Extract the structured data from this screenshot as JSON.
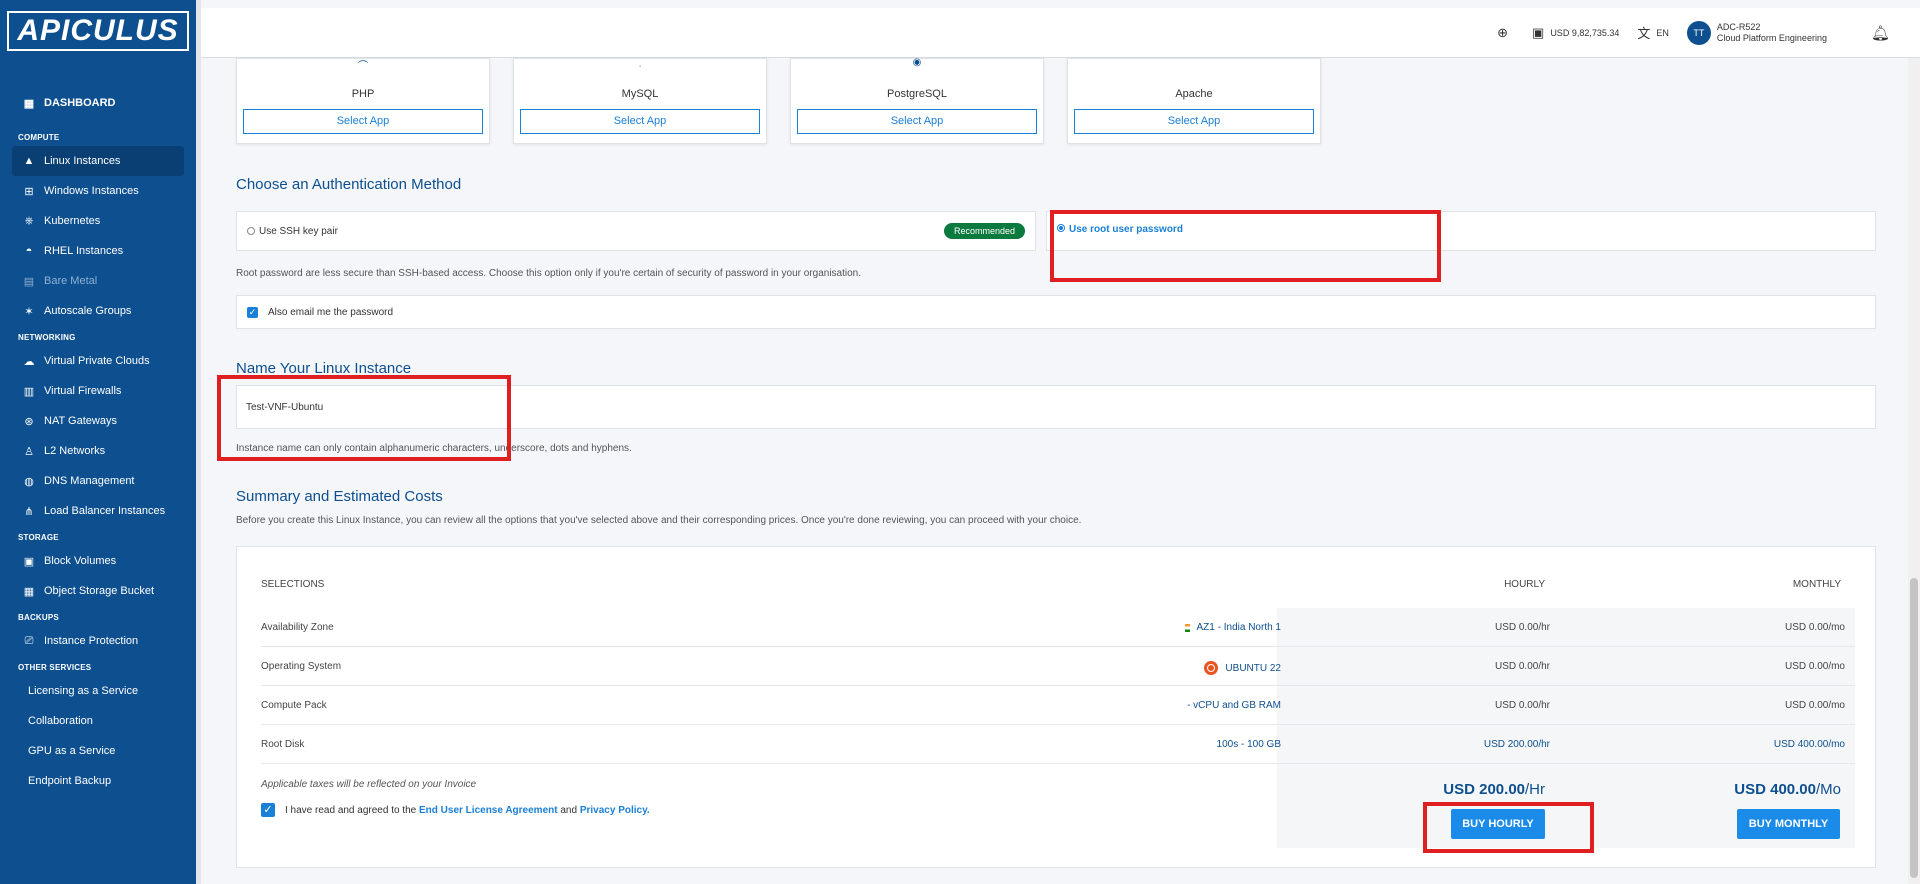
{
  "brand": {
    "logo_text": "APICULUS",
    "colors": {
      "sidebar": "#0d4f8f",
      "accent": "#1a7fd6",
      "highlight": "#e02020",
      "badge": "#0b7a3e"
    }
  },
  "sidebar": {
    "dashboard": "DASHBOARD",
    "sections": {
      "compute": "COMPUTE",
      "networking": "NETWORKING",
      "storage": "STORAGE",
      "backups": "BACKUPS",
      "other": "OTHER SERVICES"
    },
    "items": {
      "linux": "Linux Instances",
      "windows": "Windows Instances",
      "kubernetes": "Kubernetes",
      "rhel": "RHEL Instances",
      "bare_metal": "Bare Metal",
      "autoscale": "Autoscale Groups",
      "vpc": "Virtual Private Clouds",
      "firewalls": "Virtual Firewalls",
      "nat": "NAT Gateways",
      "l2": "L2 Networks",
      "dns": "DNS Management",
      "lb": "Load Balancer Instances",
      "block": "Block Volumes",
      "object": "Object Storage Bucket",
      "protection": "Instance Protection",
      "licensing": "Licensing as a Service",
      "collab": "Collaboration",
      "gpu": "GPU as a Service",
      "endpoint": "Endpoint Backup"
    }
  },
  "topbar": {
    "balance": "USD 9,82,735.34",
    "language": "EN",
    "avatar_initials": "TT",
    "org_code": "ADC-R522",
    "org_name": "Cloud Platform Engineering"
  },
  "apps": [
    {
      "name": "PHP",
      "button": "Select App"
    },
    {
      "name": "MySQL",
      "button": "Select App"
    },
    {
      "name": "PostgreSQL",
      "button": "Select App"
    },
    {
      "name": "Apache",
      "button": "Select App"
    }
  ],
  "auth": {
    "title": "Choose an Authentication Method",
    "ssh_label": "Use SSH key pair",
    "recommended": "Recommended",
    "root_label": "Use root user password",
    "selected": "root",
    "warning": "Root password are less secure than SSH-based access. Choose this option only if you're certain of security of password in your organisation.",
    "email_label": "Also email me the password",
    "email_checked": true
  },
  "name_section": {
    "title": "Name Your Linux Instance",
    "value": "Test-VNF-Ubuntu",
    "hint": "Instance name can only contain alphanumeric characters, underscore, dots and hyphens."
  },
  "summary": {
    "title": "Summary and Estimated Costs",
    "description": "Before you create this Linux Instance, you can review all the options that you've selected above and their corresponding prices. Once you're done reviewing, you can proceed with your choice.",
    "col_selections": "SELECTIONS",
    "col_hourly": "HOURLY",
    "col_monthly": "MONTHLY",
    "rows": [
      {
        "label": "Availability Zone",
        "value": "AZ1 - India North 1",
        "hourly": "USD 0.00/hr",
        "monthly": "USD 0.00/mo"
      },
      {
        "label": "Operating System",
        "value": "UBUNTU 22",
        "hourly": "USD 0.00/hr",
        "monthly": "USD 0.00/mo"
      },
      {
        "label": "Compute Pack",
        "value": "- vCPU and GB RAM",
        "hourly": "USD 0.00/hr",
        "monthly": "USD 0.00/mo"
      },
      {
        "label": "Root Disk",
        "value": "100s - 100 GB",
        "hourly": "USD 200.00/hr",
        "monthly": "USD 400.00/mo"
      }
    ],
    "tax_note": "Applicable taxes will be reflected on your Invoice",
    "agree_prefix": "I have read and agreed to the",
    "eula": "End User License Agreement",
    "and": "and",
    "privacy": "Privacy Policy.",
    "total_hourly": "USD 200.00",
    "total_hourly_unit": "/Hr",
    "total_monthly": "USD 400.00",
    "total_monthly_unit": "/Mo",
    "buy_hourly": "BUY HOURLY",
    "buy_monthly": "BUY MONTHLY"
  }
}
